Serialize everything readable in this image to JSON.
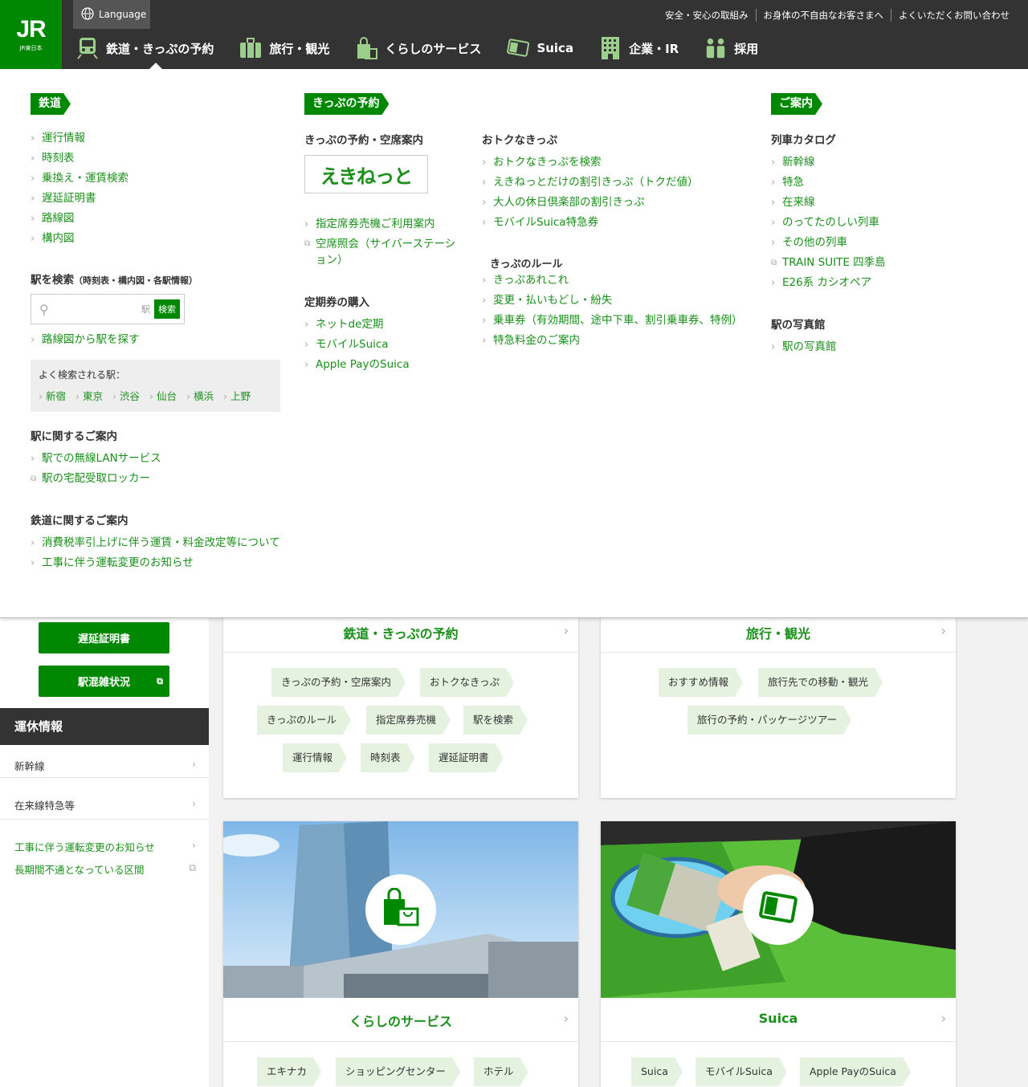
{
  "header": {
    "logo_text": "JR",
    "logo_sub": "JR東日本",
    "language": "Language",
    "util_links": [
      "安全・安心の取組み",
      "お身体の不自由なお客さまへ",
      "よくいただくお問い合わせ"
    ],
    "gnav": [
      {
        "label": "鉄道・きっぷの予約",
        "icon": "train-icon"
      },
      {
        "label": "旅行・観光",
        "icon": "suitcase-icon"
      },
      {
        "label": "くらしのサービス",
        "icon": "shopping-bag-icon"
      },
      {
        "label": "Suica",
        "icon": "suica-card-icon"
      },
      {
        "label": "企業・IR",
        "icon": "building-icon"
      },
      {
        "label": "採用",
        "icon": "people-icon"
      }
    ]
  },
  "mega": {
    "col1": {
      "flag": "鉄道",
      "links": [
        "運行情報",
        "時刻表",
        "乗換え・運賃検索",
        "遅延証明書",
        "路線図",
        "構内図"
      ],
      "station_search_title": "駅を検索",
      "station_search_note": "（時刻表・構内図・各駅情報）",
      "search_suffix": "駅",
      "search_button": "検索",
      "map_search": "路線図から駅を探す",
      "popular_title": "よく検索される駅：",
      "popular": [
        "新宿",
        "東京",
        "渋谷",
        "仙台",
        "横浜",
        "上野"
      ],
      "station_info_title": "駅に関するご案内",
      "station_info": [
        "駅での無線LANサービス",
        "駅の宅配受取ロッカー"
      ],
      "rail_info_title": "鉄道に関するご案内",
      "rail_info": [
        "消費税率引上げに伴う運賃・料金改定等について",
        "工事に伴う運転変更のお知らせ"
      ]
    },
    "col2": {
      "flag": "きっぷの予約",
      "reserve_title": "きっぷの予約・空席案内",
      "ekinet": "えきねっと",
      "reserve_links": [
        "指定席券売機ご利用案内",
        "空席照会（サイバーステーション）"
      ],
      "pass_title": "定期券の購入",
      "pass_links": [
        "ネットde定期",
        "モバイルSuica",
        "Apple PayのSuica"
      ]
    },
    "col3": {
      "deals_title": "おトクなきっぷ",
      "deals": [
        "おトクなきっぷを検索",
        "えきねっとだけの割引きっぷ（トクだ値）",
        "大人の休日倶楽部の割引きっぷ",
        "モバイルSuica特急券"
      ],
      "rules_title": "きっぷのルール",
      "rules": [
        "きっぷあれこれ",
        "変更・払いもどし・紛失",
        "乗車券（有効期間、途中下車、割引乗車券、特例）",
        "特急料金のご案内"
      ]
    },
    "col4": {
      "flag": "ご案内",
      "catalog_title": "列車カタログ",
      "catalog": [
        "新幹線",
        "特急",
        "在来線",
        "のってたのしい列車",
        "その他の列車",
        "TRAIN SUITE 四季島",
        "E26系 カシオペア"
      ],
      "photo_title": "駅の写真館",
      "photo_links": [
        "駅の写真館"
      ]
    }
  },
  "sidebar": {
    "buttons": [
      "遅延証明書",
      "駅混雑状況"
    ],
    "unkyu_title": "運休情報",
    "rows": [
      "新幹線",
      "在来線特急等"
    ],
    "notices": [
      "工事に伴う運転変更のお知らせ",
      "長期間不通となっている区間"
    ]
  },
  "cards": {
    "rail": {
      "title": "鉄道・きっぷの予約",
      "tags": [
        "きっぷの予約・空席案内",
        "おトクなきっぷ",
        "きっぷのルール",
        "指定席券売機",
        "駅を検索",
        "運行情報",
        "時刻表",
        "遅延証明書"
      ]
    },
    "travel": {
      "title": "旅行・観光",
      "tags": [
        "おすすめ情報",
        "旅行先での移動・観光",
        "旅行の予約・パッケージツアー"
      ]
    },
    "life": {
      "title": "くらしのサービス",
      "tags": [
        "エキナカ",
        "ショッピングセンター",
        "ホテル"
      ]
    },
    "suica": {
      "title": "Suica",
      "tags": [
        "Suica",
        "モバイルSuica",
        "Apple PayのSuica"
      ]
    }
  },
  "colors": {
    "brand": "#008803",
    "dark": "#333333",
    "tag": "#e4f2df"
  }
}
